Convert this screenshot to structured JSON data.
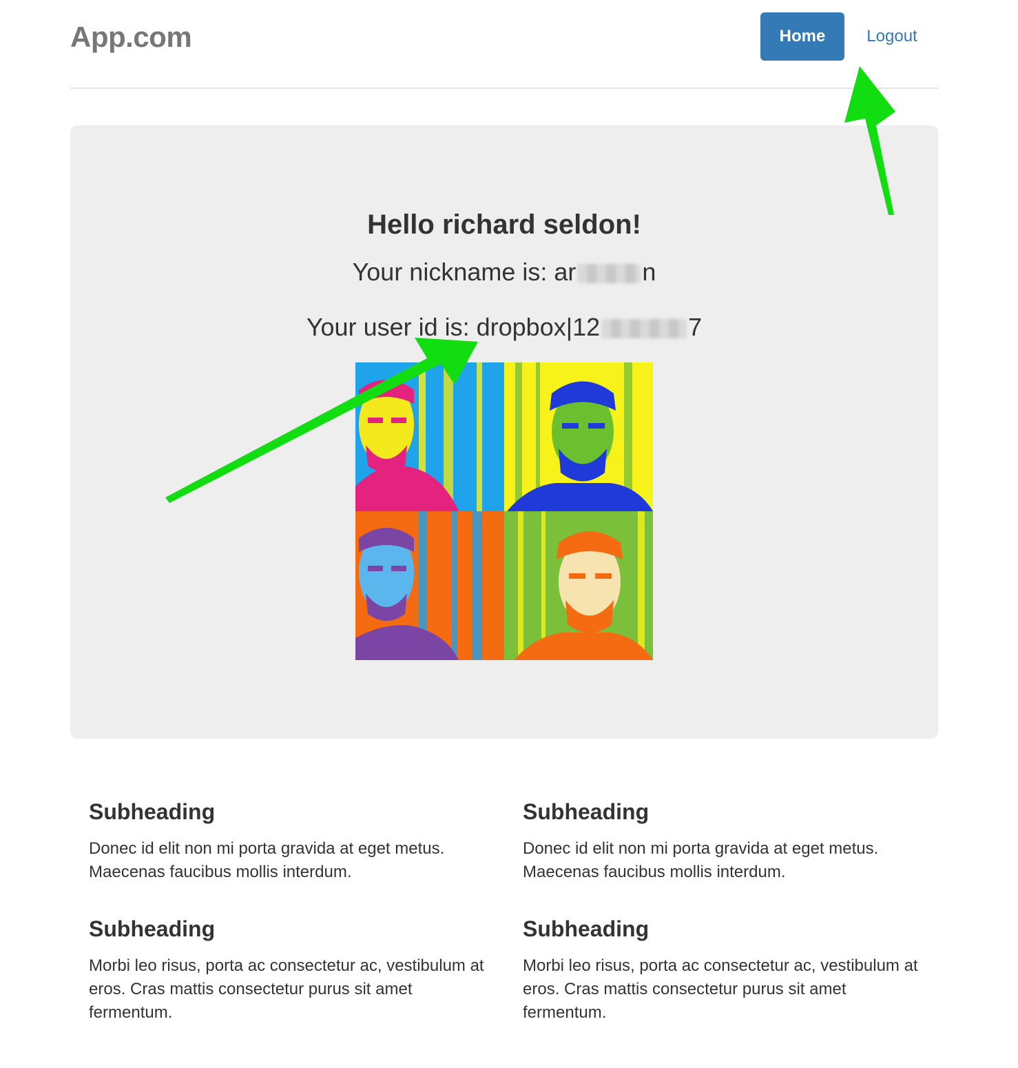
{
  "header": {
    "brand": "App.com",
    "nav": {
      "home_label": "Home",
      "logout_label": "Logout"
    }
  },
  "jumbotron": {
    "greeting": "Hello richard seldon!",
    "nickname_prefix": "Your nickname is: ar",
    "nickname_suffix": "n",
    "user_id_prefix": "Your user id is: dropbox|12",
    "user_id_suffix": "7"
  },
  "sections": [
    {
      "heading": "Subheading",
      "body": "Donec id elit non mi porta gravida at eget metus. Maecenas faucibus mollis interdum."
    },
    {
      "heading": "Subheading",
      "body": "Donec id elit non mi porta gravida at eget metus. Maecenas faucibus mollis interdum."
    },
    {
      "heading": "Subheading",
      "body": "Morbi leo risus, porta ac consectetur ac, vestibulum at eros. Cras mattis consectetur purus sit amet fermentum."
    },
    {
      "heading": "Subheading",
      "body": "Morbi leo risus, porta ac consectetur ac, vestibulum at eros. Cras mattis consectetur purus sit amet fermentum."
    }
  ],
  "colors": {
    "primary": "#337ab7",
    "jumbotron_bg": "#eeeeee",
    "annotation_arrow": "#11dd11"
  },
  "icons": {
    "avatar": "profile-photo"
  }
}
